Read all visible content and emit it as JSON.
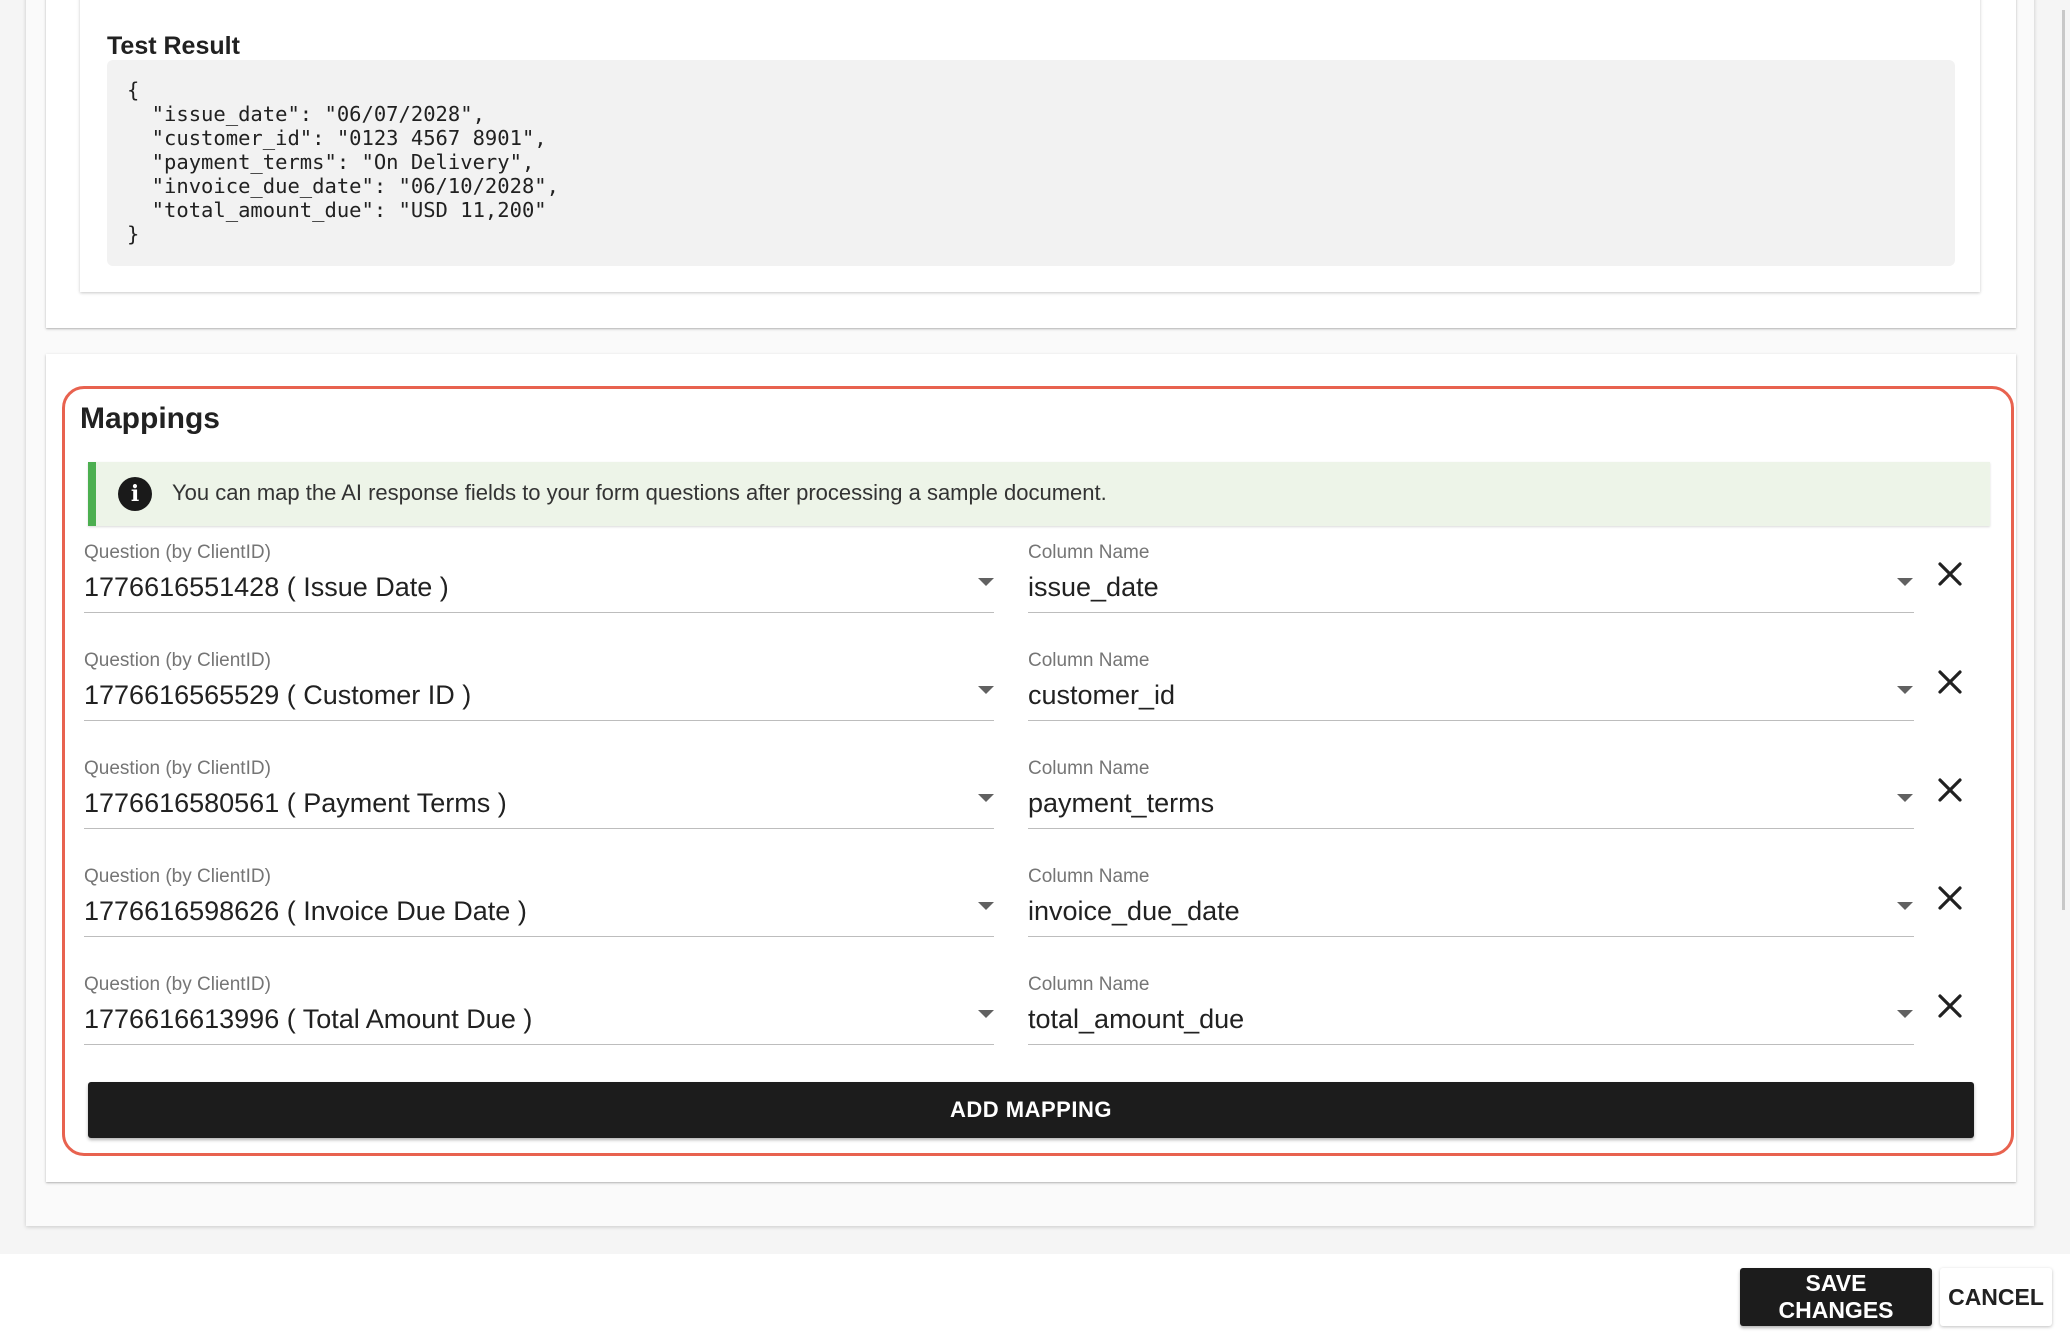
{
  "test_result": {
    "title": "Test Result",
    "json_text": "{\n  \"issue_date\": \"06/07/2028\",\n  \"customer_id\": \"0123 4567 8901\",\n  \"payment_terms\": \"On Delivery\",\n  \"invoice_due_date\": \"06/10/2028\",\n  \"total_amount_due\": \"USD 11,200\"\n}"
  },
  "mappings": {
    "title": "Mappings",
    "info_text": "You can map the AI response fields to your form questions after processing a sample document.",
    "info_icon": "info-icon",
    "question_label": "Question (by ClientID)",
    "column_label": "Column Name",
    "rows": [
      {
        "question": "1776616551428 ( Issue Date )",
        "column": "issue_date"
      },
      {
        "question": "1776616565529 ( Customer ID )",
        "column": "customer_id"
      },
      {
        "question": "1776616580561 ( Payment Terms )",
        "column": "payment_terms"
      },
      {
        "question": "1776616598626 ( Invoice Due Date )",
        "column": "invoice_due_date"
      },
      {
        "question": "1776616613996 ( Total Amount Due )",
        "column": "total_amount_due"
      }
    ],
    "add_label": "ADD MAPPING"
  },
  "footer": {
    "save_label": "SAVE CHANGES",
    "cancel_label": "CANCEL"
  },
  "colors": {
    "highlight_outline": "#e8624f",
    "info_bar": "#4caf50",
    "primary_button": "#1c1c1c"
  }
}
